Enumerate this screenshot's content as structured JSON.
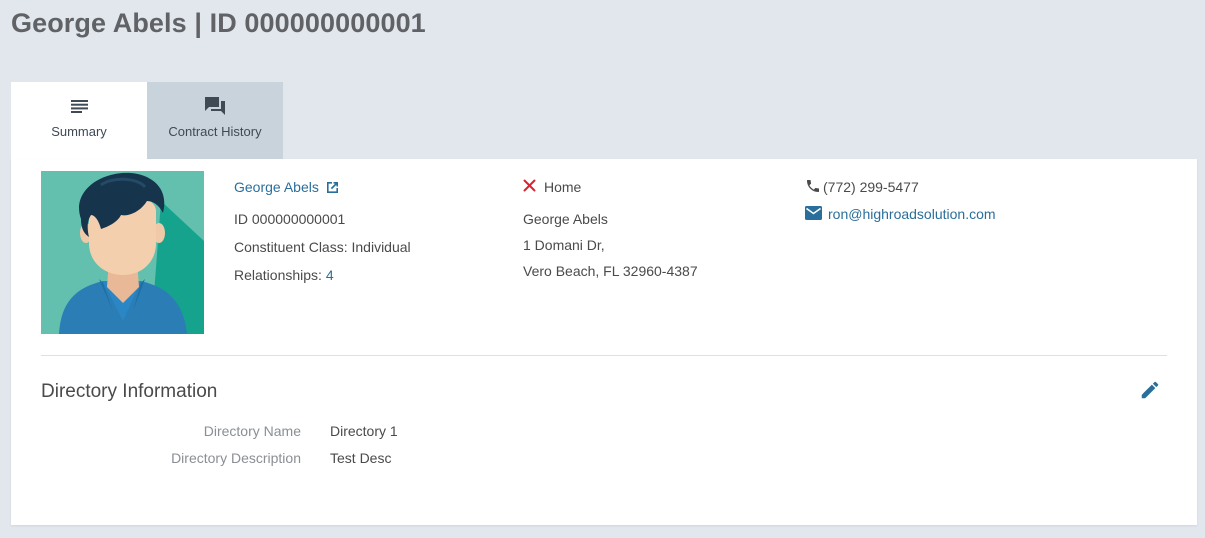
{
  "header": {
    "title": "George Abels | ID 000000000001"
  },
  "tabs": [
    {
      "label": "Summary",
      "icon": "list-lines-icon",
      "active": true
    },
    {
      "label": "Contract History",
      "icon": "chat-bubbles-icon",
      "active": false
    }
  ],
  "profile": {
    "name": "George Abels",
    "id_text": "ID 000000000001",
    "class_label": "Constituent Class:",
    "class_value": "Individual",
    "relationships_label": "Relationships:",
    "relationships_count": "4"
  },
  "address": {
    "type_label": "Home",
    "name": "George Abels",
    "line1": "1 Domani Dr,",
    "line2": "Vero Beach, FL 32960-4387"
  },
  "contact": {
    "phone": "(772) 299-5477",
    "email": "ron@highroadsolution.com"
  },
  "directory": {
    "title": "Directory Information",
    "rows": [
      {
        "label": "Directory Name",
        "value": "Directory 1"
      },
      {
        "label": "Directory Description",
        "value": "Test Desc"
      }
    ]
  },
  "colors": {
    "background": "#e2e7ee",
    "link": "#2a6f9b",
    "avatar_bg": "#63bfae",
    "remove_red": "#d9232f",
    "edit_blue": "#2a6f9b"
  }
}
